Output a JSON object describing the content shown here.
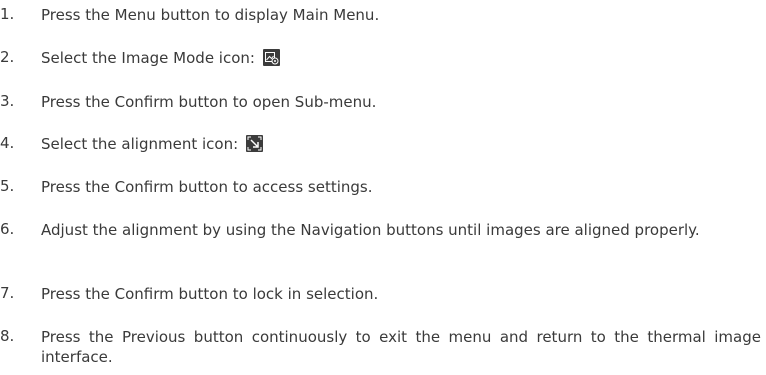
{
  "steps": [
    {
      "num": "1.",
      "text": "Press the Menu button to display Main Menu."
    },
    {
      "num": "2.",
      "text": "Select the Image Mode icon:",
      "icon": "image-mode-icon"
    },
    {
      "num": "3.",
      "text": "Press the Confirm button to open Sub-menu."
    },
    {
      "num": "4.",
      "text": "Select the alignment icon:",
      "icon": "alignment-icon"
    },
    {
      "num": "5.",
      "text": "Press the Confirm button to access settings."
    },
    {
      "num": "6.",
      "text": "Adjust the alignment by using the Navigation buttons until images are aligned properly."
    },
    {
      "num": "7.",
      "text": "Press the Confirm button to lock in selection."
    },
    {
      "num": "8.",
      "text": "Press the Previous button continuously to exit the menu and return to the thermal image interface."
    }
  ],
  "colors": {
    "text": "#3a3a3a",
    "icon_background": "#3c3c3c"
  }
}
